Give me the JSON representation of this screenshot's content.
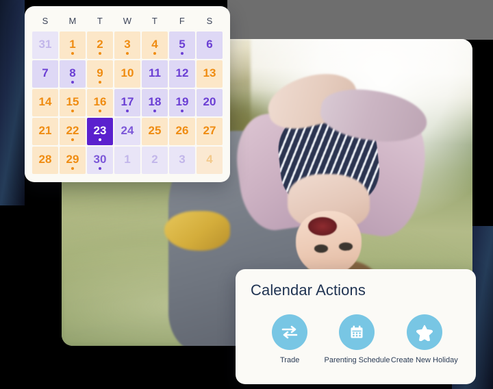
{
  "calendar": {
    "weekdays": [
      "S",
      "M",
      "T",
      "W",
      "T",
      "F",
      "S"
    ],
    "days": [
      {
        "num": "31",
        "type": "muted-purple",
        "dot": false
      },
      {
        "num": "1",
        "type": "orange",
        "dot": true
      },
      {
        "num": "2",
        "type": "orange",
        "dot": true
      },
      {
        "num": "3",
        "type": "orange",
        "dot": true
      },
      {
        "num": "4",
        "type": "orange",
        "dot": true
      },
      {
        "num": "5",
        "type": "purple",
        "dot": true
      },
      {
        "num": "6",
        "type": "purple",
        "dot": false
      },
      {
        "num": "7",
        "type": "purple",
        "dot": false
      },
      {
        "num": "8",
        "type": "purple",
        "dot": true
      },
      {
        "num": "9",
        "type": "orange",
        "dot": true
      },
      {
        "num": "10",
        "type": "orange",
        "dot": false
      },
      {
        "num": "11",
        "type": "purple",
        "dot": false
      },
      {
        "num": "12",
        "type": "purple",
        "dot": false
      },
      {
        "num": "13",
        "type": "orange",
        "dot": false
      },
      {
        "num": "14",
        "type": "orange",
        "dot": false
      },
      {
        "num": "15",
        "type": "orange",
        "dot": true
      },
      {
        "num": "16",
        "type": "orange",
        "dot": true
      },
      {
        "num": "17",
        "type": "purple",
        "dot": true
      },
      {
        "num": "18",
        "type": "purple",
        "dot": true
      },
      {
        "num": "19",
        "type": "purple",
        "dot": true
      },
      {
        "num": "20",
        "type": "purple",
        "dot": false
      },
      {
        "num": "21",
        "type": "orange",
        "dot": false
      },
      {
        "num": "22",
        "type": "orange",
        "dot": true
      },
      {
        "num": "23",
        "type": "selected",
        "dot": true
      },
      {
        "num": "24",
        "type": "purple-lite",
        "dot": false
      },
      {
        "num": "25",
        "type": "orange",
        "dot": false
      },
      {
        "num": "26",
        "type": "orange",
        "dot": false
      },
      {
        "num": "27",
        "type": "orange",
        "dot": false
      },
      {
        "num": "28",
        "type": "orange",
        "dot": false
      },
      {
        "num": "29",
        "type": "orange",
        "dot": true
      },
      {
        "num": "30",
        "type": "purple-lite",
        "dot": true
      },
      {
        "num": "1",
        "type": "muted-purple",
        "dot": false
      },
      {
        "num": "2",
        "type": "muted-purple",
        "dot": false
      },
      {
        "num": "3",
        "type": "muted-purple",
        "dot": false
      },
      {
        "num": "4",
        "type": "muted-orange",
        "dot": false
      }
    ]
  },
  "actions_panel": {
    "title": "Calendar Actions",
    "actions": [
      {
        "label": "Trade",
        "icon": "swap-arrows-icon"
      },
      {
        "label": "Parenting Schedule",
        "icon": "calendar-icon"
      },
      {
        "label": "Create New Holiday",
        "icon": "star-icon"
      }
    ]
  },
  "colors": {
    "selected_day": "#5b21ce",
    "purple_day_bg": "#ded8f5",
    "purple_day_text": "#6b3fd4",
    "orange_day_bg": "#fce7c8",
    "orange_day_text": "#ef8c12",
    "action_circle": "#78c6e4",
    "card_bg": "#fbfaf5",
    "title_text": "#1f3352"
  }
}
